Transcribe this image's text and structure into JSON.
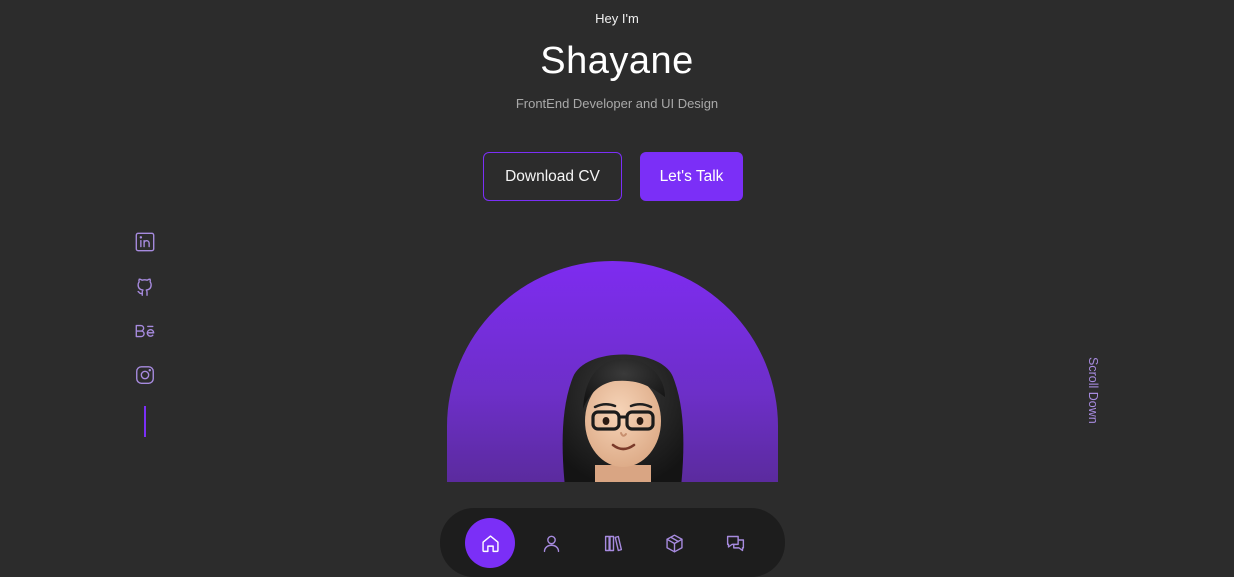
{
  "hero": {
    "greeting": "Hey I'm",
    "name": "Shayane",
    "subtitle": "FrontEnd Developer and UI Design"
  },
  "actions": {
    "download_cv": "Download CV",
    "lets_talk": "Let's Talk"
  },
  "socials": [
    {
      "icon": "linkedin-icon"
    },
    {
      "icon": "github-icon"
    },
    {
      "icon": "behance-icon"
    },
    {
      "icon": "instagram-icon"
    }
  ],
  "scroll_label": "Scroll Down",
  "nav": [
    {
      "icon": "home-icon",
      "active": true
    },
    {
      "icon": "user-icon",
      "active": false
    },
    {
      "icon": "books-icon",
      "active": false
    },
    {
      "icon": "cube-icon",
      "active": false
    },
    {
      "icon": "chat-icon",
      "active": false
    }
  ],
  "colors": {
    "background": "#2c2c2c",
    "accent": "#7b2ff7",
    "nav_background": "#1d1d1d",
    "icon": "#a78bdf"
  }
}
